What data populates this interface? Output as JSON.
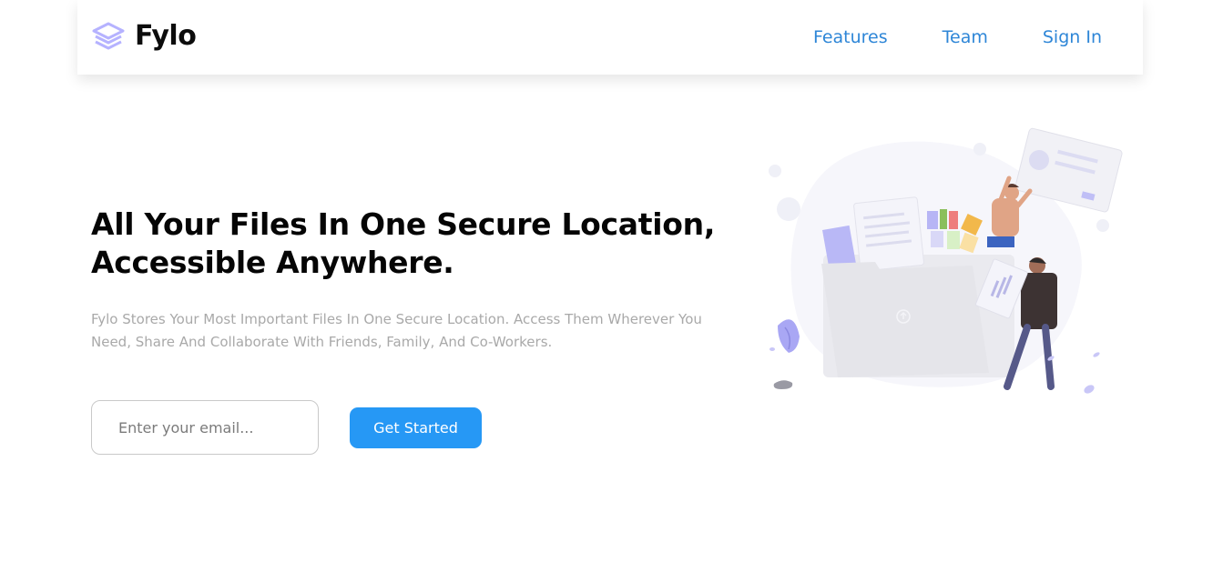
{
  "header": {
    "brand": "Fylo",
    "nav": [
      {
        "label": "Features"
      },
      {
        "label": "Team"
      },
      {
        "label": "Sign In"
      }
    ]
  },
  "hero": {
    "title": "All Your Files In One Secure Location, Accessible Anywhere.",
    "description": "Fylo Stores Your Most Important Files In One Secure Location. Access Them Wherever You Need, Share And Collaborate With Friends, Family, And Co-Workers.",
    "email_placeholder": "Enter your email...",
    "email_value": "",
    "cta_label": "Get Started"
  },
  "colors": {
    "accent": "#2698f5",
    "nav_link": "#2e86d7",
    "logo_mark": "#b5b2ff"
  },
  "icons": {
    "logo": "stacked-layers-icon",
    "illustration": "file-folder-illustration"
  }
}
